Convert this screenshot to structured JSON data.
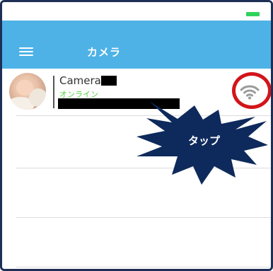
{
  "header": {
    "title": "カメラ"
  },
  "camera_list": {
    "items": [
      {
        "name": "Camera",
        "status": "オンライン"
      }
    ]
  },
  "annotation": {
    "label": "タップ"
  },
  "colors": {
    "header_bg": "#4eb2e6",
    "status_online": "#55d046",
    "highlight_ring": "#d2151a",
    "callout_fill": "#0e2a5c",
    "battery": "#2fd35a"
  },
  "icons": {
    "menu": "menu-icon",
    "wifi": "wifi-icon",
    "battery": "battery-icon"
  }
}
